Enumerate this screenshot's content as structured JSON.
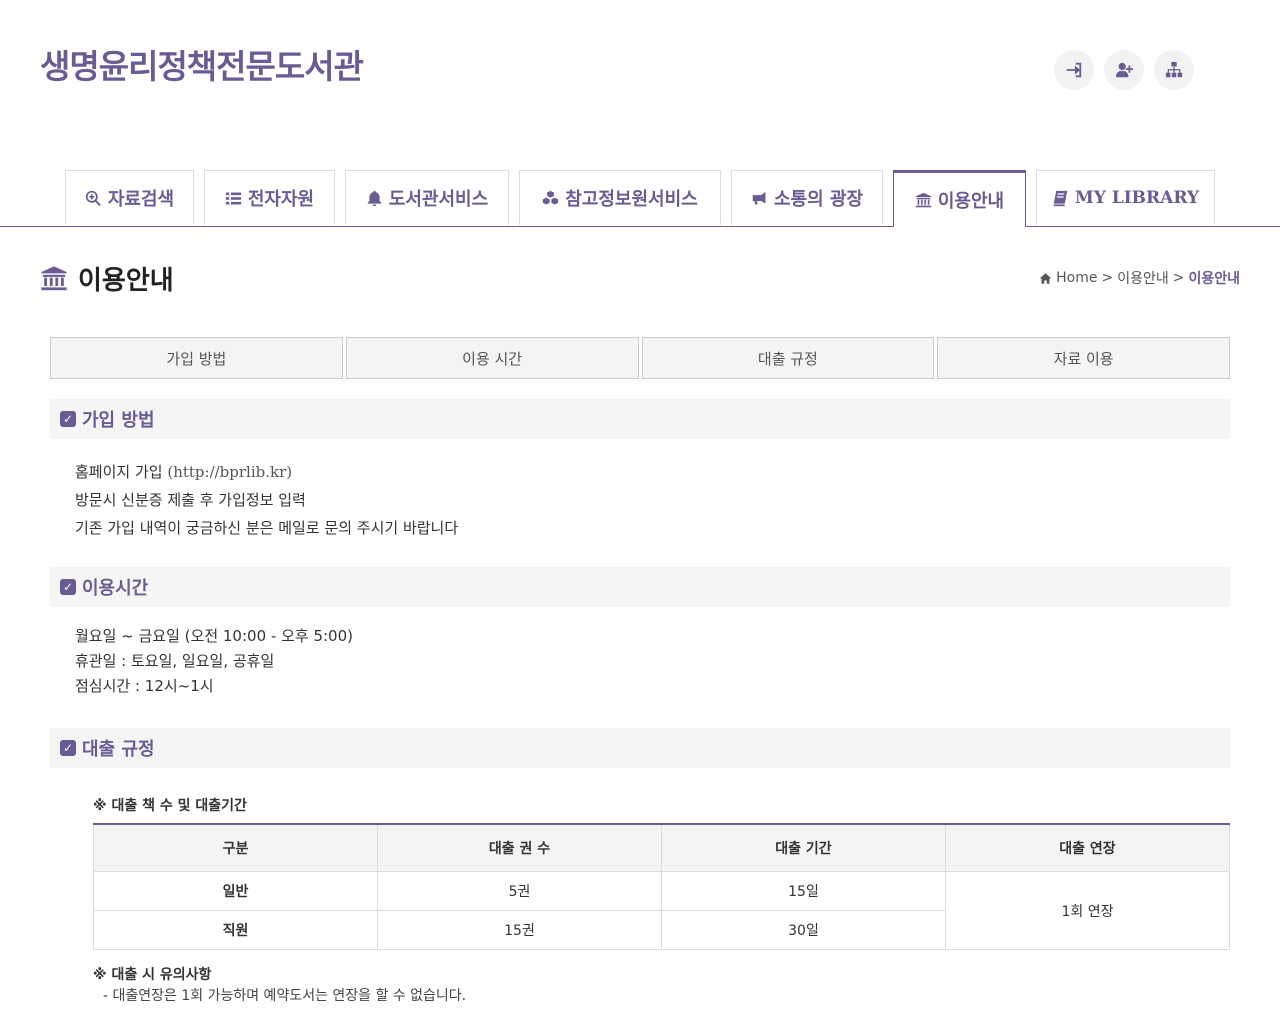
{
  "site": {
    "title": "생명윤리정책전문도서관"
  },
  "top_icons": [
    "login-icon",
    "join-icon",
    "sitemap-icon"
  ],
  "nav": {
    "tabs": [
      {
        "label": "자료검색",
        "icon": "search-plus-icon"
      },
      {
        "label": "전자자원",
        "icon": "list-icon"
      },
      {
        "label": "도서관서비스",
        "icon": "bell-icon"
      },
      {
        "label": "참고정보원서비스",
        "icon": "cubes-icon"
      },
      {
        "label": "소통의 광장",
        "icon": "bullhorn-icon"
      },
      {
        "label": "이용안내",
        "icon": "institution-icon",
        "active": true
      },
      {
        "label": "MY LIBRARY",
        "icon": "book-icon"
      }
    ]
  },
  "page": {
    "title": "이용안내",
    "breadcrumb": {
      "home": "Home",
      "sep": ">",
      "parent": "이용안내",
      "current": "이용안내"
    }
  },
  "subtabs": [
    "가입 방법",
    "이용 시간",
    "대출 규정",
    "자료 이용"
  ],
  "sections": {
    "join": {
      "title": "가입 방법",
      "lines": [
        {
          "text": "홈페이지 가입 ",
          "extra": "(http://bprlib.kr)"
        },
        {
          "text": "방문시 신분증 제출 후 가입정보 입력"
        },
        {
          "text": "기존 가입 내역이 궁금하신 분은 메일로 문의 주시기 바랍니다"
        }
      ]
    },
    "hours": {
      "title": "이용시간",
      "lines": [
        "월요일 ~ 금요일 (오전 10:00 - 오후 5:00)",
        "휴관일 : 토요일, 일요일, 공휴일",
        "점심시간 : 12시~1시"
      ]
    },
    "loan": {
      "title": "대출 규정",
      "table_caption": "※ 대출 책 수 및 대출기간",
      "table": {
        "headers": [
          "구분",
          "대출 권 수",
          "대출 기간",
          "대출 연장"
        ],
        "rows": [
          {
            "type": "일반",
            "count": "5권",
            "period": "15일"
          },
          {
            "type": "직원",
            "count": "15권",
            "period": "30일"
          }
        ],
        "extension": "1회 연장"
      },
      "notes_title": "※ 대출 시 유의사항",
      "notes": [
        "- 대출연장은 1회 가능하며 예약도서는 연장을 할 수 없습니다."
      ]
    }
  },
  "colors": {
    "accent": "#6b5b95"
  }
}
